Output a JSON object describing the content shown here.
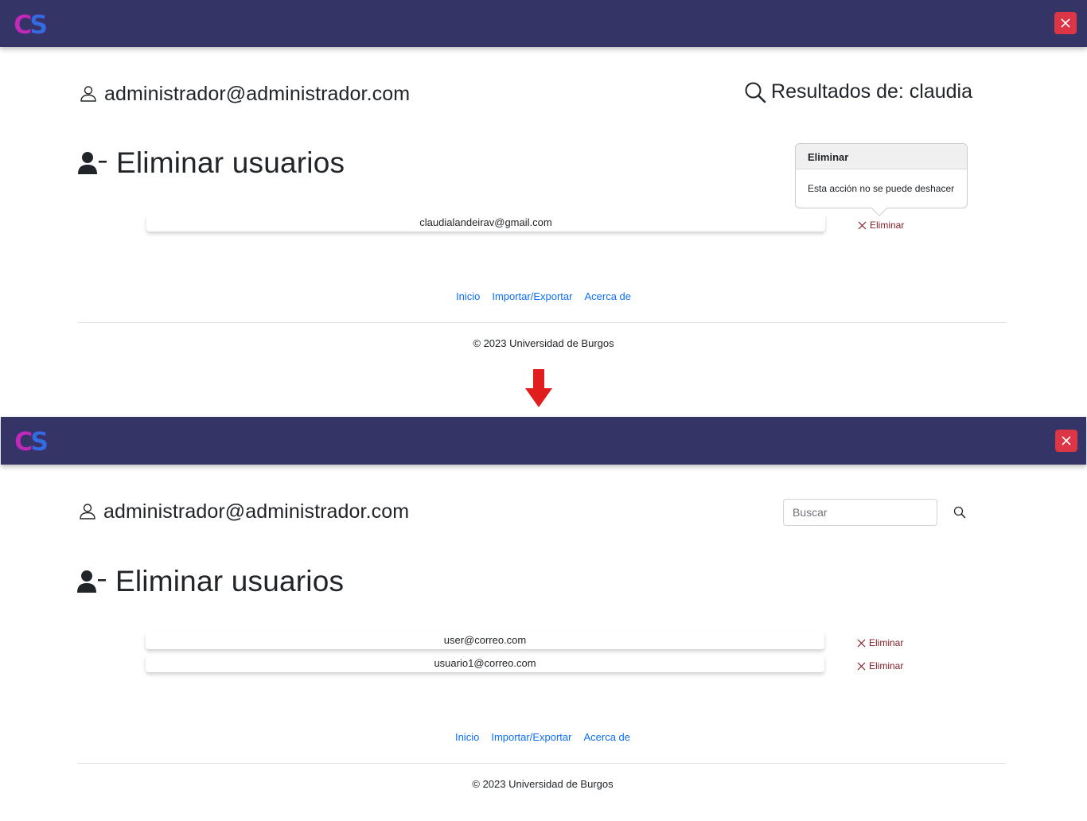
{
  "brand": {
    "logo_text": "CS"
  },
  "user": {
    "email": "administrador@administrador.com"
  },
  "top_state": {
    "results_label": "Resultados de: claudia",
    "heading": "Eliminar usuarios",
    "users": [
      {
        "email": "claudialandeirav@gmail.com",
        "delete_label": "Eliminar"
      }
    ],
    "popover": {
      "title": "Eliminar",
      "body": "Esta acción no se puede deshacer"
    }
  },
  "bottom_state": {
    "search_placeholder": "Buscar",
    "heading": "Eliminar usuarios",
    "users": [
      {
        "email": "user@correo.com",
        "delete_label": "Eliminar"
      },
      {
        "email": "usuario1@correo.com",
        "delete_label": "Eliminar"
      }
    ]
  },
  "footer": {
    "links": [
      "Inicio",
      "Importar/Exportar",
      "Acerca de"
    ],
    "copyright": "© 2023 Universidad de Burgos"
  },
  "colors": {
    "navbar": "#343466",
    "close_button": "#dc3545",
    "link": "#0d6efd",
    "delete_link": "#842029",
    "transition_arrow": "#e01e1e"
  },
  "icons": [
    "close-icon",
    "user-icon",
    "search-icon",
    "user-minus-icon",
    "x-icon",
    "arrow-down-icon"
  ]
}
